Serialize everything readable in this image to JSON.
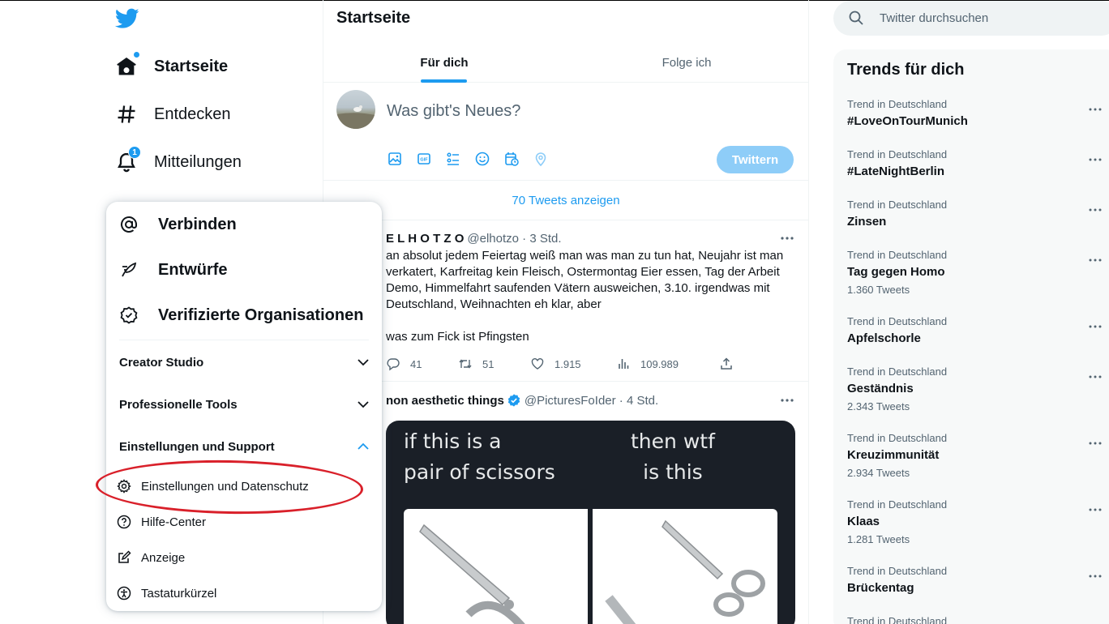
{
  "colors": {
    "accent": "#1d9bf0",
    "text": "#0f1419",
    "secondary": "#536471",
    "annotation_circle": "#d9202a"
  },
  "nav": {
    "items": [
      {
        "label": "Startseite",
        "icon": "home-icon"
      },
      {
        "label": "Entdecken",
        "icon": "hashtag-icon"
      },
      {
        "label": "Mitteilungen",
        "icon": "bell-icon",
        "badge": "1"
      }
    ]
  },
  "menu": {
    "main": [
      {
        "label": "Verbinden",
        "icon": "at-icon"
      },
      {
        "label": "Entwürfe",
        "icon": "feather-icon"
      },
      {
        "label": "Verifizierte Organisationen",
        "icon": "verified-org-icon"
      }
    ],
    "sections": [
      {
        "label": "Creator Studio",
        "expanded": false
      },
      {
        "label": "Professionelle Tools",
        "expanded": false
      },
      {
        "label": "Einstellungen und Support",
        "expanded": true
      }
    ],
    "sub": [
      {
        "label": "Einstellungen und Datenschutz",
        "icon": "gear-icon",
        "highlighted": true
      },
      {
        "label": "Hilfe-Center",
        "icon": "help-icon"
      },
      {
        "label": "Anzeige",
        "icon": "edit-display-icon"
      },
      {
        "label": "Tastaturkürzel",
        "icon": "accessibility-icon"
      }
    ]
  },
  "center": {
    "title": "Startseite",
    "tabs": [
      {
        "label": "Für dich",
        "active": true
      },
      {
        "label": "Folge ich",
        "active": false
      }
    ],
    "compose": {
      "placeholder": "Was gibt's Neues?",
      "button": "Twittern"
    },
    "show_tweets": "70 Tweets anzeigen",
    "tweets": [
      {
        "name": "E L H O T Z O",
        "meta": "@elhotzo · 3 Std.",
        "text": "an absolut jedem Feiertag weiß man was man zu tun hat, Neujahr ist man verkatert, Karfreitag kein Fleisch, Ostermontag Eier essen, Tag der Arbeit Demo, Himmelfahrt saufenden Vätern ausweichen, 3.10. irgendwas mit Deutschland, Weihnachten eh klar, aber\n\nwas zum Fick ist Pfingsten",
        "replies": "41",
        "retweets": "51",
        "likes": "1.915",
        "views": "109.989"
      },
      {
        "name": "non aesthetic things",
        "verified": true,
        "meta": "@PicturesFoIder · 4 Std.",
        "media_left": "if this is a\npair of scissors",
        "media_right": "then wtf\nis this"
      }
    ]
  },
  "search": {
    "placeholder": "Twitter durchsuchen"
  },
  "trends": {
    "title": "Trends für dich",
    "items": [
      {
        "context": "Trend in Deutschland",
        "name": "#LoveOnTourMunich",
        "count": ""
      },
      {
        "context": "Trend in Deutschland",
        "name": "#LateNightBerlin",
        "count": ""
      },
      {
        "context": "Trend in Deutschland",
        "name": "Zinsen",
        "count": ""
      },
      {
        "context": "Trend in Deutschland",
        "name": "Tag gegen Homo",
        "count": "1.360 Tweets"
      },
      {
        "context": "Trend in Deutschland",
        "name": "Apfelschorle",
        "count": ""
      },
      {
        "context": "Trend in Deutschland",
        "name": "Geständnis",
        "count": "2.343 Tweets"
      },
      {
        "context": "Trend in Deutschland",
        "name": "Kreuzimmunität",
        "count": "2.934 Tweets"
      },
      {
        "context": "Trend in Deutschland",
        "name": "Klaas",
        "count": "1.281 Tweets"
      },
      {
        "context": "Trend in Deutschland",
        "name": "Brückentag",
        "count": ""
      },
      {
        "context": "Trend in Deutschland",
        "name": "",
        "count": ""
      }
    ]
  }
}
